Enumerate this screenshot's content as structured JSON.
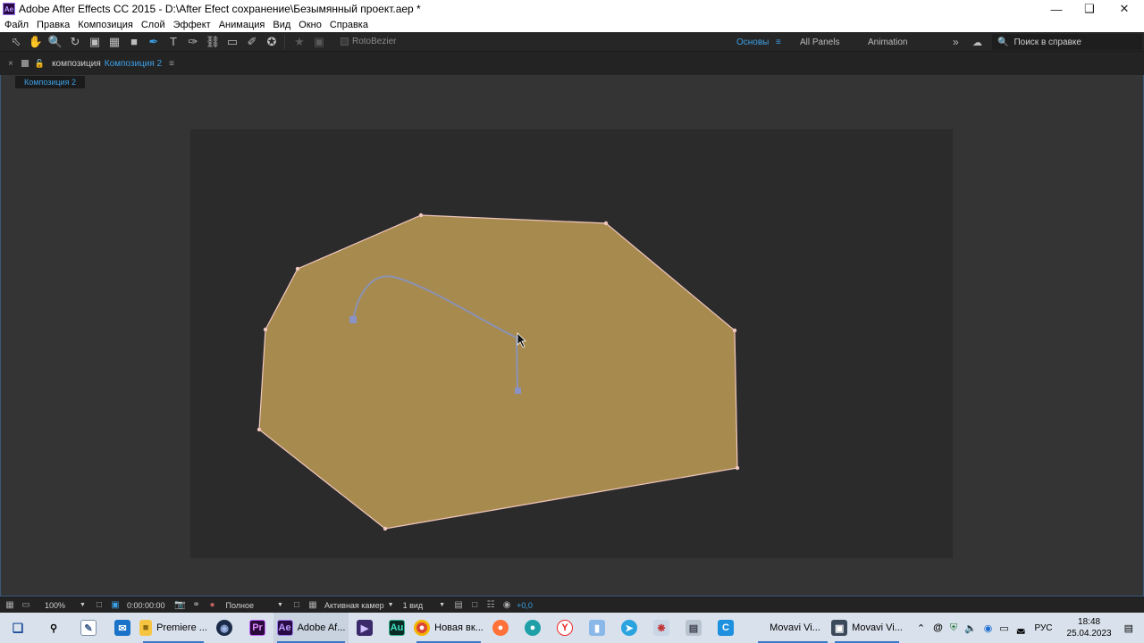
{
  "window": {
    "title": "Adobe After Effects CC 2015 - D:\\After Efect сохранение\\Безымянный проект.aep *",
    "app_icon": "Ae",
    "controls": [
      "minimize-icon",
      "maximize-icon",
      "close-icon"
    ]
  },
  "menu": [
    "Файл",
    "Правка",
    "Композиция",
    "Слой",
    "Эффект",
    "Анимация",
    "Вид",
    "Окно",
    "Справка"
  ],
  "toolbar": {
    "rotobezier_label": "RotoBezier",
    "workspaces": [
      "Основы",
      "All Panels",
      "Animation"
    ],
    "active_workspace": "Основы",
    "help_placeholder": "Поиск в справке"
  },
  "panel": {
    "name": "композиция",
    "comp_name": "Композиция 2",
    "tab_label": "Композиция 2"
  },
  "composition": {
    "shape_fill": "#a78a4d",
    "shape_stroke": "#f1c7c0",
    "path_color": "#8a92b6"
  },
  "status": {
    "zoom": "100%",
    "timecode": "0:00:00:00",
    "resolution": "Полное",
    "camera": "Активная камер",
    "views": "1 вид",
    "exposure": "+0,0"
  },
  "taskbar": {
    "items": [
      {
        "label": "Premiere ...",
        "icon": "folder-icon"
      },
      {
        "label": "Adobe Af...",
        "icon": "after-effects-icon"
      },
      {
        "label": "Новая вк...",
        "icon": "chrome-icon"
      },
      {
        "label": "Movavi Vi...",
        "icon": "movavi-icon"
      },
      {
        "label": "Movavi Vi...",
        "icon": "movavi-icon"
      }
    ],
    "app_icons": {
      "premiere": "Pr",
      "audition": "Au",
      "after_effects": "Ae"
    },
    "language": "РУС",
    "time": "18:48",
    "date": "25.04.2023"
  }
}
